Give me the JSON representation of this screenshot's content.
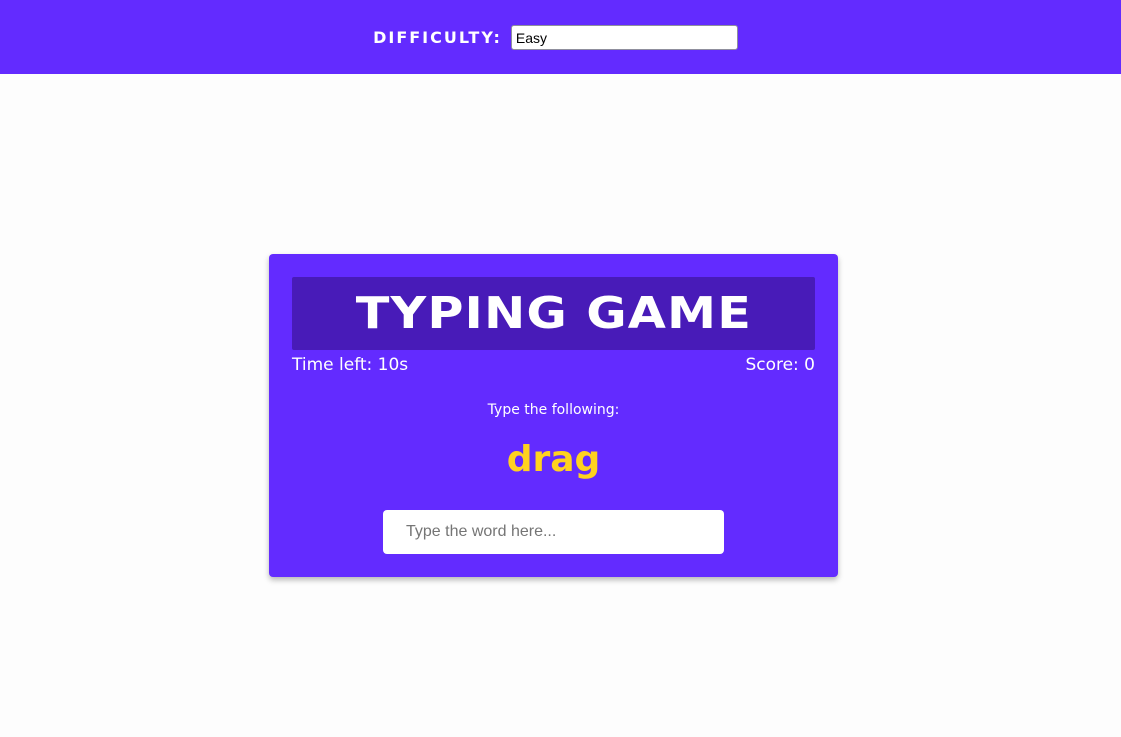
{
  "settings": {
    "difficulty_label": "DIFFICULTY:",
    "difficulty_value": "Easy"
  },
  "game": {
    "title": "TYPING GAME",
    "time_left": "Time left: 10s",
    "score": "Score: 0",
    "instruction": "Type the following:",
    "current_word": "drag",
    "input_placeholder": "Type the word here...",
    "input_value": ""
  },
  "colors": {
    "primary": "#632bff",
    "title_bg": "#481bb8",
    "word": "#ffd21f",
    "page_bg": "#fdfdfd"
  }
}
